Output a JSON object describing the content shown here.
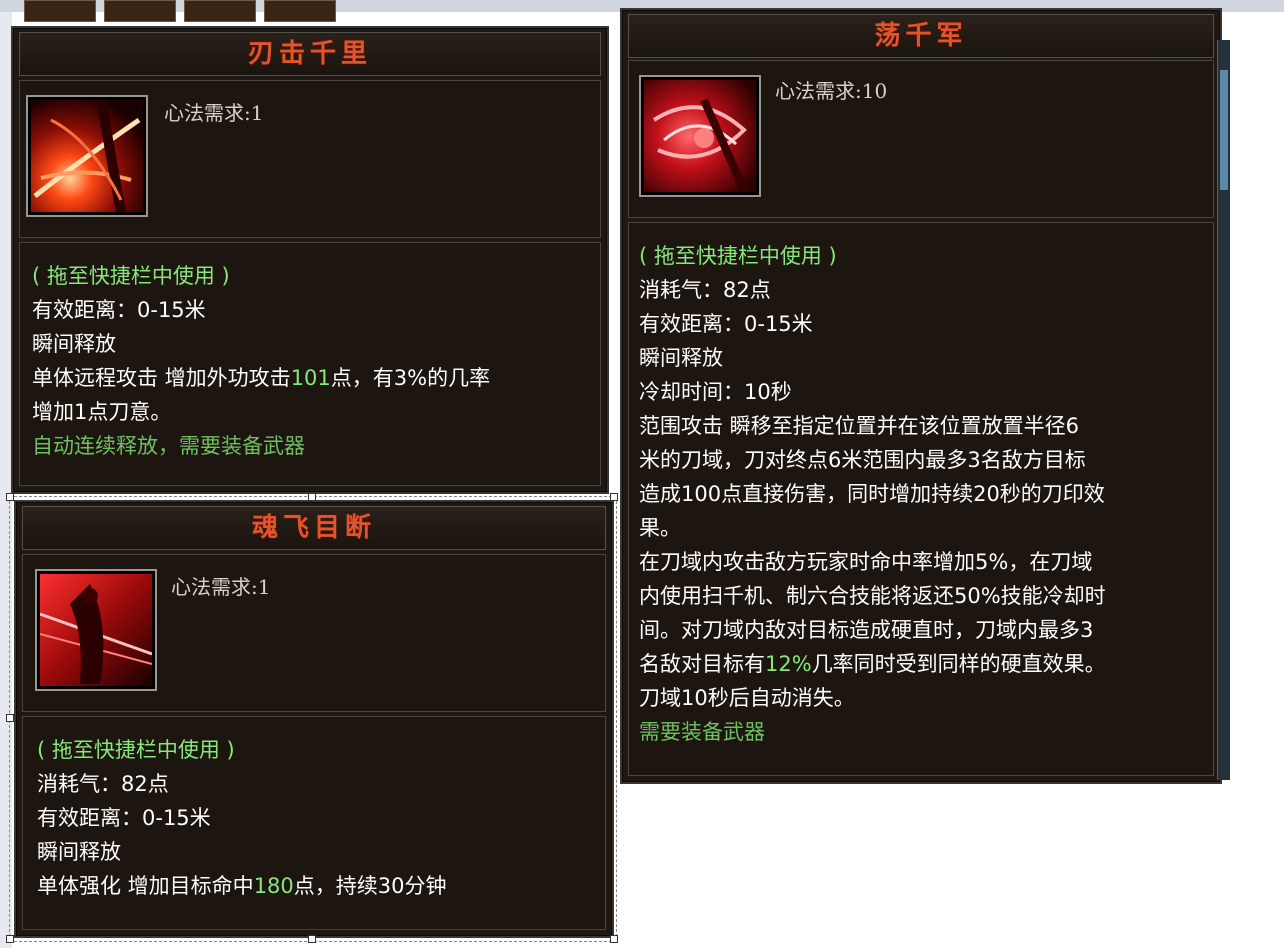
{
  "panels": {
    "p1": {
      "title": "刃击千里",
      "requirement": "心法需求:1",
      "use_hint": "( 拖至快捷栏中使用 )",
      "range": "有效距离：0-15米",
      "cast": "瞬间释放",
      "desc_a": "单体远程攻击 增加外功攻击",
      "desc_num": "101",
      "desc_b": "点，有3%的几率",
      "desc_c": "增加1点刀意。",
      "note": "自动连续释放，需要装备武器"
    },
    "p2": {
      "title": "荡千军",
      "requirement": "心法需求:10",
      "use_hint": "( 拖至快捷栏中使用 )",
      "cost": "消耗气：82点",
      "range": "有效距离：0-15米",
      "cast": "瞬间释放",
      "cooldown": "冷却时间：10秒",
      "desc_1": "范围攻击 瞬移至指定位置并在该位置放置半径6",
      "desc_2": "米的刀域，刀对终点6米范围内最多3名敌方目标",
      "desc_3": "造成100点直接伤害，同时增加持续20秒的刀印效",
      "desc_4": "果。",
      "desc_5": "在刀域内攻击敌方玩家时命中率增加5%，在刀域",
      "desc_6": "内使用扫千机、制六合技能将返还50%技能冷却时",
      "desc_7": "间。对刀域内敌对目标造成硬直时，刀域内最多3",
      "desc_8a": "名敌对目标有",
      "desc_8num": "12%",
      "desc_8b": "几率同时受到同样的硬直效果。",
      "desc_9": "刀域10秒后自动消失。",
      "note": "需要装备武器"
    },
    "p3": {
      "title": "魂飞目断",
      "requirement": "心法需求:1",
      "use_hint": "( 拖至快捷栏中使用 )",
      "cost": "消耗气：82点",
      "range": "有效距离：0-15米",
      "cast": "瞬间释放",
      "desc_a": "单体强化 增加目标命中",
      "desc_num": "180",
      "desc_b": "点，持续30分钟"
    }
  },
  "icons": {
    "p1": "blade-slash-skill-icon",
    "p2": "crimson-vortex-skill-icon",
    "p3": "red-warrior-skill-icon"
  },
  "colors": {
    "title": "#e2542a",
    "body_text": "#ffffff",
    "hint_green": "#86e87a",
    "panel_bg": "#1f1813"
  }
}
